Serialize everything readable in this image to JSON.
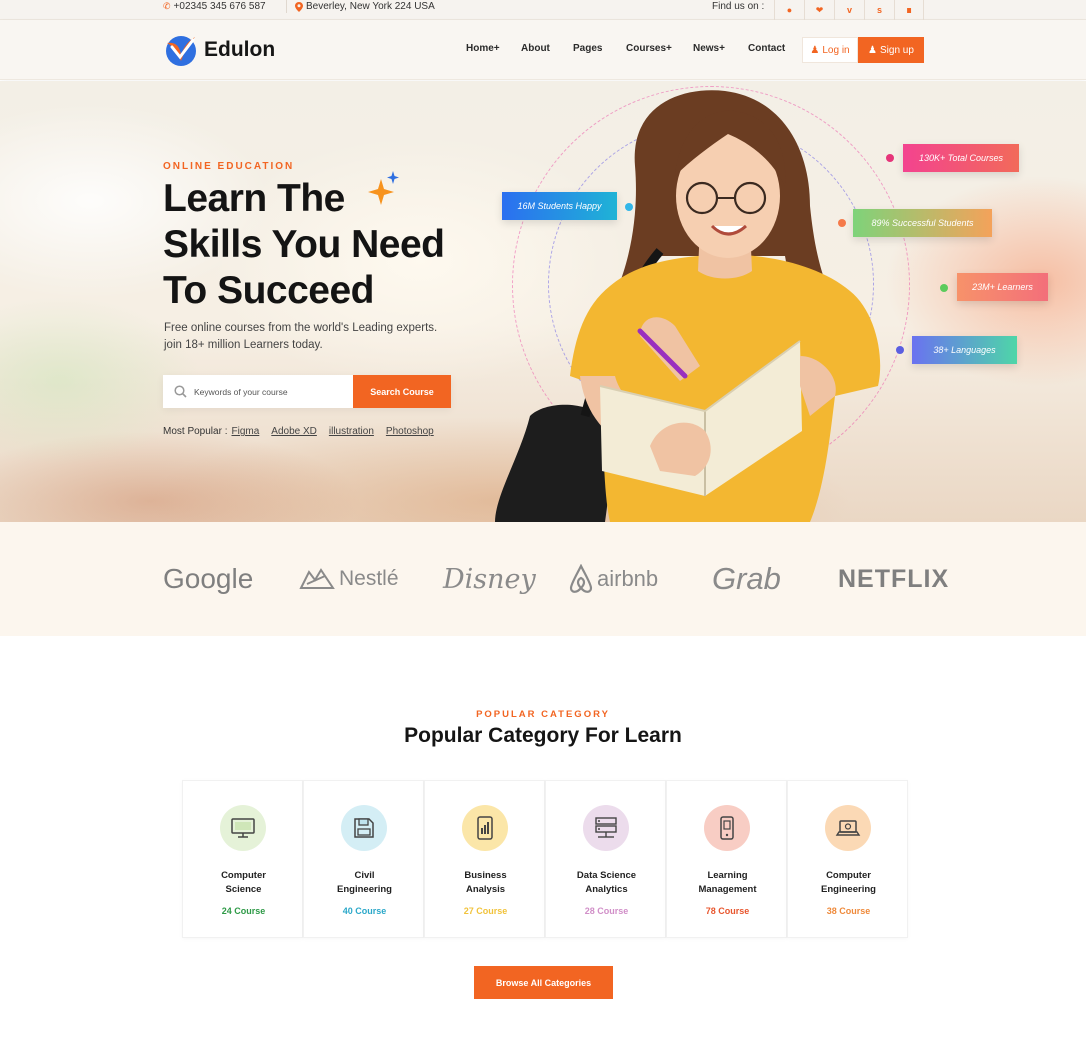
{
  "topbar": {
    "phone": "+02345 345 676 587",
    "address": "Beverley, New York 224 USA",
    "find_us": "Find us on :",
    "social_icons": [
      "pinterest-icon",
      "twitter-icon",
      "vimeo-icon",
      "skype-icon",
      "rss-icon"
    ]
  },
  "header": {
    "logo_text": "Edulon",
    "nav": [
      "Home+",
      "About",
      "Pages",
      "Courses+",
      "News+",
      "Contact"
    ],
    "login_label": "Log in",
    "signup_label": "Sign up"
  },
  "hero": {
    "eyebrow": "ONLINE EDUCATION",
    "title_lines": [
      "Learn The",
      "Skills You Need",
      "To Succeed"
    ],
    "subtitle_lines": [
      "Free online courses from the world's Leading experts.",
      "join 18+ million Learners today."
    ],
    "search_placeholder": "Keywords of your course",
    "search_button": "Search Course",
    "popular_label": "Most Popular :",
    "popular_links": [
      "Figma",
      "Adobe XD",
      "illustration",
      "Photoshop"
    ],
    "tags": {
      "students_happy": "16M Students Happy",
      "total_courses": "130K+ Total Courses",
      "successful_students": "89% Successful Students",
      "learners": "23M+ Learners",
      "languages": "38+ Languages"
    }
  },
  "brands": [
    "Google",
    "Nestlé",
    "Disney",
    "airbnb",
    "Grab",
    "NETFLIX"
  ],
  "categories": {
    "eyebrow": "POPULAR CATEGORY",
    "title": "Popular Category For Learn",
    "items": [
      {
        "name_1": "Computer",
        "name_2": "Science",
        "count": "24 Course"
      },
      {
        "name_1": "Civil",
        "name_2": "Engineering",
        "count": "40 Course"
      },
      {
        "name_1": "Business",
        "name_2": "Analysis",
        "count": "27 Course"
      },
      {
        "name_1": "Data Science",
        "name_2": "Analytics",
        "count": "28 Course"
      },
      {
        "name_1": "Learning",
        "name_2": "Management",
        "count": "78 Course"
      },
      {
        "name_1": "Computer",
        "name_2": "Engineering",
        "count": "38 Course"
      }
    ],
    "browse_button": "Browse All Categories"
  },
  "colors": {
    "accent": "#f26522",
    "tag_pink": "#f04f8c",
    "tag_blue": "#2575e8",
    "tag_green": "#7ed37a",
    "tag_orange": "#f7926a",
    "tag_teal": "#4ed6a8"
  }
}
